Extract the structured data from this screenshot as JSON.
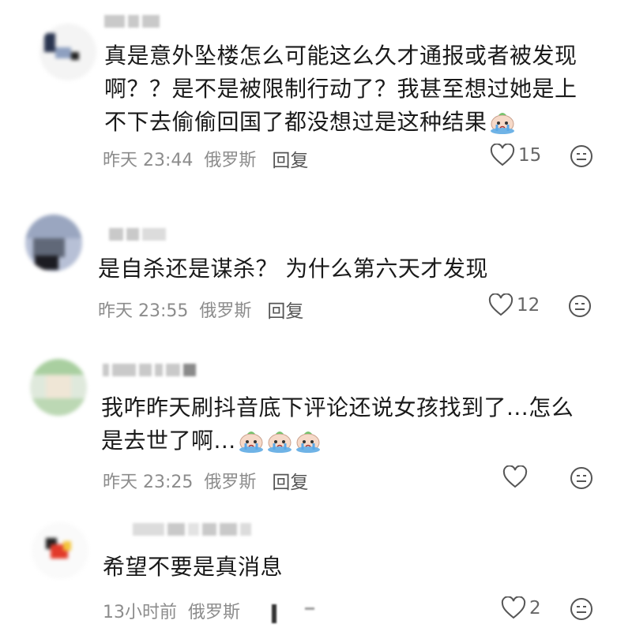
{
  "comments": [
    {
      "text_lines": [
        "真是意外坠楼怎么可能这么久才通报或者被发现",
        "啊？？是不是被限制行动了？我甚至想过她是上",
        "不下去偷偷回国了都没想过是这种结果"
      ],
      "emoji_count": 1,
      "time": "昨天 23:44",
      "location": "俄罗斯",
      "reply_label": "回复",
      "likes": "15"
    },
    {
      "text_lines": [
        "是自杀还是谋杀？ 为什么第六天才发现"
      ],
      "emoji_count": 0,
      "time": "昨天 23:55",
      "location": "俄罗斯",
      "reply_label": "回复",
      "likes": "12"
    },
    {
      "text_lines": [
        "我咋昨天刷抖音底下评论还说女孩找到了...怎么",
        "是去世了啊..."
      ],
      "emoji_count": 3,
      "time": "昨天 23:25",
      "location": "俄罗斯",
      "reply_label": "回复",
      "likes": ""
    },
    {
      "text_lines": [
        "希望不要是真消息"
      ],
      "emoji_count": 0,
      "time": "13小时前",
      "location": "俄罗斯",
      "reply_label": "",
      "likes": "2"
    }
  ],
  "icons": [
    "heart-icon",
    "smile-icon",
    "crying-emoji-icon"
  ],
  "colors": {
    "meta": "#8c8c8c",
    "text": "#1a1a1a",
    "background": "#ffffff"
  }
}
